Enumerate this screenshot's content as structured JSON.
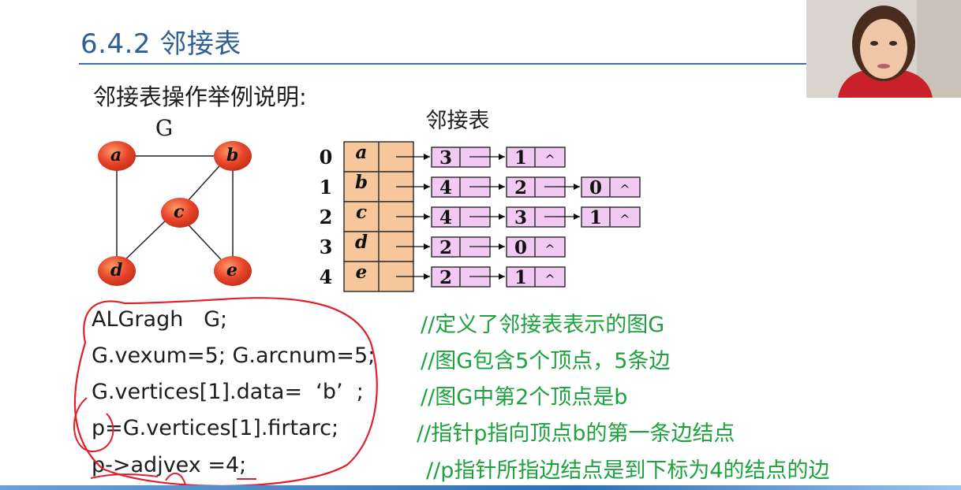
{
  "slide": {
    "title": "6.4.2 邻接表",
    "subtitle": "邻接表操作举例说明:"
  },
  "graph": {
    "label": "G",
    "vertices": [
      "a",
      "b",
      "c",
      "d",
      "e"
    ]
  },
  "adjacency": {
    "label": "邻接表",
    "rows": [
      {
        "index": "0",
        "vertex": "a",
        "edges": [
          "3",
          "1"
        ]
      },
      {
        "index": "1",
        "vertex": "b",
        "edges": [
          "4",
          "2",
          "0"
        ]
      },
      {
        "index": "2",
        "vertex": "c",
        "edges": [
          "4",
          "3",
          "1"
        ]
      },
      {
        "index": "3",
        "vertex": "d",
        "edges": [
          "2",
          "0"
        ]
      },
      {
        "index": "4",
        "vertex": "e",
        "edges": [
          "2",
          "1"
        ]
      }
    ],
    "null_symbol": "^"
  },
  "code": [
    {
      "code": "ALGragh   G;",
      "comment": "//定义了邻接表表示的图G"
    },
    {
      "code": "G.vexum=5; G.arcnum=5;",
      "comment": "//图G包含5个顶点，5条边"
    },
    {
      "code": "G.vertices[1].data=  ‘b’  ;",
      "comment": "//图G中第2个顶点是b"
    },
    {
      "code": "p=G.vertices[1].firtarc;",
      "comment": "//指针p指向顶点b的第一条边结点"
    },
    {
      "code": "p->adjvex =4;",
      "comment": "//p指针所指边结点是到下标为4的结点的边"
    }
  ],
  "colors": {
    "title": "#2e5f97",
    "comment": "#1ea23e",
    "node_fill": "#e8462a",
    "vertex_cell": "#f6c79a",
    "edge_cell": "#f2c9f2",
    "annotation": "#e0202a"
  }
}
